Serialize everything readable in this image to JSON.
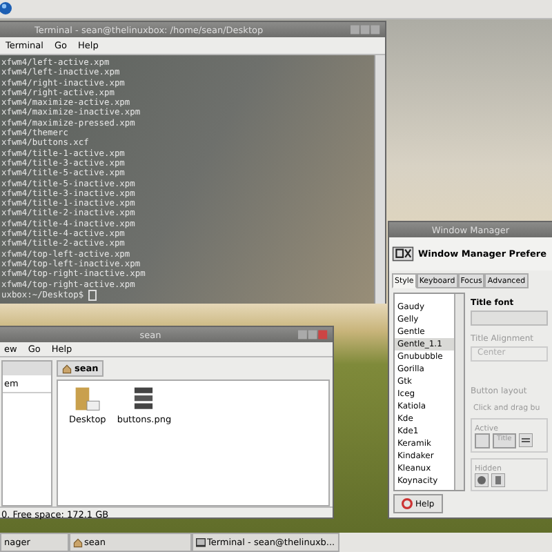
{
  "terminal": {
    "title": "Terminal - sean@thelinuxbox: /home/sean/Desktop",
    "menu": [
      "Terminal",
      "Go",
      "Help"
    ],
    "lines": [
      "xfwm4/left-active.xpm",
      "xfwm4/left-inactive.xpm",
      "xfwm4/right-inactive.xpm",
      "xfwm4/right-active.xpm",
      "xfwm4/maximize-active.xpm",
      "xfwm4/maximize-inactive.xpm",
      "xfwm4/maximize-pressed.xpm",
      "xfwm4/themerc",
      "xfwm4/buttons.xcf",
      "xfwm4/title-1-active.xpm",
      "xfwm4/title-3-active.xpm",
      "xfwm4/title-5-active.xpm",
      "xfwm4/title-5-inactive.xpm",
      "xfwm4/title-3-inactive.xpm",
      "xfwm4/title-1-inactive.xpm",
      "xfwm4/title-2-inactive.xpm",
      "xfwm4/title-4-inactive.xpm",
      "xfwm4/title-4-active.xpm",
      "xfwm4/title-2-active.xpm",
      "xfwm4/top-left-active.xpm",
      "xfwm4/top-left-inactive.xpm",
      "xfwm4/top-right-inactive.xpm",
      "xfwm4/top-right-active.xpm"
    ],
    "prompt": "uxbox:~/Desktop$"
  },
  "file_manager": {
    "title": "sean",
    "menu": [
      "ew",
      "Go",
      "Help"
    ],
    "sidebar": [
      "em"
    ],
    "path_button": "sean",
    "files": [
      {
        "name": "Desktop",
        "kind": "folder"
      },
      {
        "name": "buttons.png",
        "kind": "image"
      }
    ],
    "status": "0. Free space: 172.1 GB"
  },
  "wm_prefs": {
    "title": "Window Manager",
    "heading": "Window Manager Prefere",
    "tabs": [
      {
        "label": "Style",
        "selected": true
      },
      {
        "label": "Keyboard",
        "selected": false
      },
      {
        "label": "Focus",
        "selected": false
      },
      {
        "label": "Advanced",
        "selected": false
      }
    ],
    "themes": [
      {
        "label": "Gaudy",
        "selected": false
      },
      {
        "label": "Gelly",
        "selected": false
      },
      {
        "label": "Gentle",
        "selected": false
      },
      {
        "label": "Gentle_1.1",
        "selected": true
      },
      {
        "label": "Gnububble",
        "selected": false
      },
      {
        "label": "Gorilla",
        "selected": false
      },
      {
        "label": "Gtk",
        "selected": false
      },
      {
        "label": "Iceg",
        "selected": false
      },
      {
        "label": "Katiola",
        "selected": false
      },
      {
        "label": "Kde",
        "selected": false
      },
      {
        "label": "Kde1",
        "selected": false
      },
      {
        "label": "Keramik",
        "selected": false
      },
      {
        "label": "Kindaker",
        "selected": false
      },
      {
        "label": "Kleanux",
        "selected": false
      },
      {
        "label": "Koynacity",
        "selected": false
      }
    ],
    "title_font_label": "Title font",
    "title_alignment_label": "Title Alignment",
    "alignment_value": "Center",
    "button_layout_label": "Button layout",
    "hint": "Click and drag bu",
    "active_label": "Active",
    "active_button": "Title",
    "hidden_label": "Hidden",
    "help": "Help"
  },
  "taskbar": [
    {
      "label": "nager",
      "kind": "plain"
    },
    {
      "label": "sean",
      "kind": "home"
    },
    {
      "label": "Terminal - sean@thelinuxb...",
      "kind": "terminal"
    }
  ]
}
